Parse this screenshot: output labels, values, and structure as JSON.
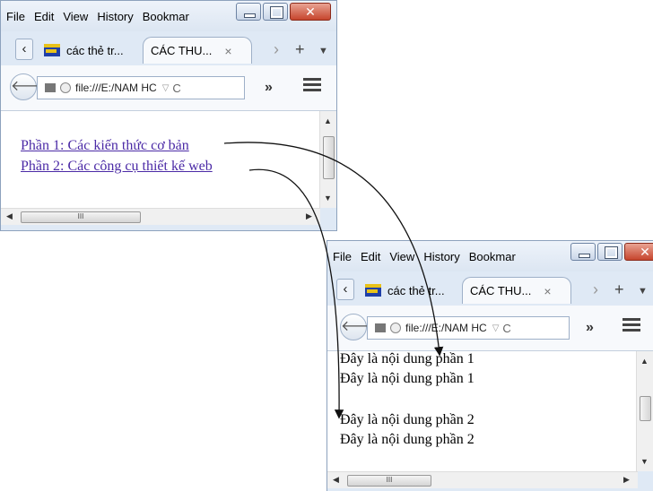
{
  "browser1": {
    "menu": [
      "File",
      "Edit",
      "View",
      "History",
      "Bookmar"
    ],
    "tabs": [
      {
        "label": "các thẻ tr..."
      },
      {
        "label": "CÁC THU...",
        "close": "×"
      }
    ],
    "url": "file:///E:/NAM HC",
    "overflow": "»",
    "links": [
      "Phần 1: Các kiến thức cơ bản",
      "Phần 2: Các công cụ thiết kế web"
    ],
    "hscroll_label": "III"
  },
  "browser2": {
    "menu": [
      "File",
      "Edit",
      "View",
      "History",
      "Bookmar"
    ],
    "tabs": [
      {
        "label": "các thẻ tr..."
      },
      {
        "label": "CÁC THU...",
        "close": "×"
      }
    ],
    "url": "file:///E:/NAM HC",
    "overflow": "»",
    "lines": [
      "Đây là nội dung phần 1",
      "Đây là nội dung phần 1",
      "Đây là nội dung phần 2",
      "Đây là nội dung phần 2"
    ],
    "hscroll_label": "III"
  },
  "icons": {
    "back": "back-arrow-icon",
    "tab_prev": "chevron-left-icon",
    "tab_next": "chevron-right-icon",
    "new_tab": "plus-icon",
    "tab_list": "chevron-down-icon",
    "reload": "reload-icon",
    "menu": "hamburger-menu-icon"
  },
  "colors": {
    "link": "#4b2aa6",
    "close_button": "#c6452d",
    "chrome": "#dfe9f5"
  }
}
